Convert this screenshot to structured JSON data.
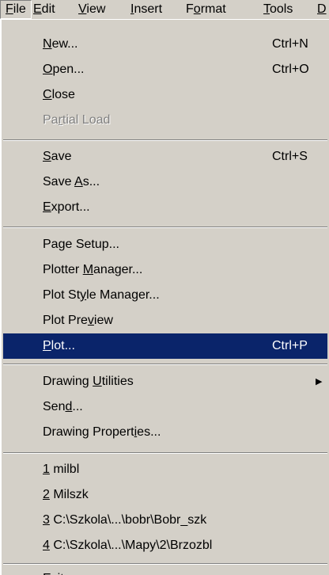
{
  "menubar": {
    "items": [
      {
        "pre": "",
        "key": "F",
        "post": "ile"
      },
      {
        "pre": "",
        "key": "E",
        "post": "dit"
      },
      {
        "pre": "",
        "key": "V",
        "post": "iew"
      },
      {
        "pre": "",
        "key": "I",
        "post": "nsert"
      },
      {
        "pre": "F",
        "key": "o",
        "post": "rmat"
      },
      {
        "pre": "",
        "key": "T",
        "post": "ools"
      },
      {
        "pre": "",
        "key": "D",
        "post": ""
      }
    ]
  },
  "file_menu": {
    "group1": {
      "new": {
        "pre": "",
        "key": "N",
        "post": "ew...",
        "shortcut": "Ctrl+N"
      },
      "open": {
        "pre": "",
        "key": "O",
        "post": "pen...",
        "shortcut": "Ctrl+O"
      },
      "close": {
        "pre": "",
        "key": "C",
        "post": "lose"
      },
      "partial_load": {
        "pre": "Pa",
        "key": "r",
        "post": "tial Load"
      }
    },
    "group2": {
      "save": {
        "pre": "",
        "key": "S",
        "post": "ave",
        "shortcut": "Ctrl+S"
      },
      "save_as": {
        "pre": "Save ",
        "key": "A",
        "post": "s..."
      },
      "export": {
        "pre": "",
        "key": "E",
        "post": "xport..."
      }
    },
    "group3": {
      "page_setup": {
        "pre": "Pa",
        "key": "g",
        "post": "e Setup..."
      },
      "plotter_manager": {
        "pre": "Plotter ",
        "key": "M",
        "post": "anager..."
      },
      "plot_style_manager": {
        "pre": "Plot St",
        "key": "y",
        "post": "le Manager..."
      },
      "plot_preview": {
        "pre": "Plot Pre",
        "key": "v",
        "post": "iew"
      },
      "plot": {
        "pre": "",
        "key": "P",
        "post": "lot...",
        "shortcut": "Ctrl+P"
      }
    },
    "group4": {
      "drawing_utilities": {
        "pre": "Drawing ",
        "key": "U",
        "post": "tilities"
      },
      "send": {
        "pre": "Sen",
        "key": "d",
        "post": "..."
      },
      "drawing_properties": {
        "pre": "Drawing Propert",
        "key": "i",
        "post": "es..."
      }
    },
    "recent": {
      "r1": {
        "key": "1",
        "post": " milbl"
      },
      "r2": {
        "key": "2",
        "post": " Milszk"
      },
      "r3": {
        "key": "3",
        "post": " C:\\Szkola\\...\\bobr\\Bobr_szk"
      },
      "r4": {
        "key": "4",
        "post": " C:\\Szkola\\...\\Mapy\\2\\Brzozbl"
      }
    },
    "exit": {
      "pre": "E",
      "key": "x",
      "post": "it"
    }
  },
  "colors": {
    "face": "#d4d0c8",
    "highlight": "#0a246a",
    "disabled": "#808080"
  },
  "icons": {
    "submenu": "submenu-arrow-icon"
  }
}
